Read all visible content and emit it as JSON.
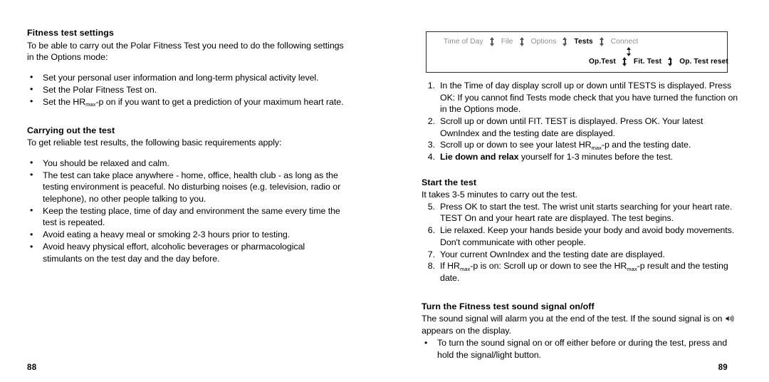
{
  "left_page": {
    "page_number": "88",
    "sections": [
      {
        "title": "Fitness test settings",
        "intro": "To be able to carry out the Polar Fitness Test you need to do the following settings in the Options mode:",
        "bullets": [
          {
            "pre": "Set your personal user information and long-term physical activity level.",
            "sub": "",
            "post": ""
          },
          {
            "pre": "Set the Polar Fitness Test on.",
            "sub": "",
            "post": ""
          },
          {
            "pre": "Set the HR",
            "sub": "max",
            "post": "-p on if you want to get a prediction of your maximum heart rate."
          }
        ]
      },
      {
        "title": "Carrying out the test",
        "intro": "To get reliable test results, the following basic requirements apply:",
        "bullets": [
          {
            "pre": "You should be relaxed and calm.",
            "sub": "",
            "post": ""
          },
          {
            "pre": "The test can take place anywhere - home, office, health club - as long as the testing environment is peaceful. No disturbing noises (e.g. television, radio or telephone), no other people talking to you.",
            "sub": "",
            "post": ""
          },
          {
            "pre": "Keep the testing place, time of day and environment the same every time the test is repeated.",
            "sub": "",
            "post": ""
          },
          {
            "pre": "Avoid eating a heavy meal or smoking 2-3 hours prior to testing.",
            "sub": "",
            "post": ""
          },
          {
            "pre": "Avoid heavy physical effort, alcoholic beverages or pharmacological stimulants on the test day and the day before.",
            "sub": "",
            "post": ""
          }
        ]
      }
    ]
  },
  "right_page": {
    "page_number": "89",
    "menu_diagram": {
      "top_row": [
        "Time of Day",
        "File",
        "Options",
        "Tests",
        "Connect"
      ],
      "top_row_active": "Tests",
      "bottom_row": [
        "Op.Test",
        "Fit. Test",
        "Op. Test reset"
      ],
      "separator_icon": "up-down-arrow-icon",
      "branch_icon": "up-down-arrow-icon"
    },
    "steps_group_1": [
      {
        "num": "1.",
        "pre": "In the Time of day display scroll up or down until TESTS is displayed. Press OK: If you cannot find Tests mode check that you have turned the function on in the Options mode.",
        "bold": "",
        "sub": "",
        "post": ""
      },
      {
        "num": "2.",
        "pre": "Scroll up or down until FIT. TEST is displayed. Press OK. Your latest OwnIndex and the testing date are displayed.",
        "bold": "",
        "sub": "",
        "post": ""
      },
      {
        "num": "3.",
        "pre": "Scroll up or down to see your latest HR",
        "bold": "",
        "sub": "max",
        "post": "-p and the testing date."
      },
      {
        "num": "4.",
        "pre": "",
        "bold": "Lie down and relax",
        "sub": "",
        "post": " yourself for 1-3 minutes before the test."
      }
    ],
    "start_section": {
      "title": "Start the test",
      "intro": "It takes 3-5 minutes to carry out the test.",
      "steps": [
        {
          "num": "5.",
          "pre": "Press OK to start the test. The wrist unit starts searching for your heart rate. TEST On and your heart rate are displayed. The test begins.",
          "sub": "",
          "mid": "",
          "post": ""
        },
        {
          "num": "6.",
          "pre": "Lie relaxed. Keep your hands beside your body and avoid body movements. Don't communicate with other people.",
          "sub": "",
          "mid": "",
          "post": ""
        },
        {
          "num": "7.",
          "pre": "Your current OwnIndex and the testing date are displayed.",
          "sub": "",
          "mid": "",
          "post": ""
        },
        {
          "num": "8.",
          "pre": "If HR",
          "sub": "max",
          "mid": "-p is on: Scroll up or down to see the HR",
          "sub2": "max",
          "post": "-p result and the testing date."
        }
      ]
    },
    "sound_section": {
      "title": "Turn the Fitness test sound signal on/off",
      "intro_part1": "The sound signal will alarm you at the end of the test. If the sound signal is on ",
      "icon_name": "sound-signal-icon",
      "intro_part2": " appears on the display.",
      "bullets": [
        "To turn the sound signal on or off either before or during the test, press and hold the signal/light button."
      ]
    }
  },
  "colors": {
    "text": "#000000",
    "muted": "#8d8d8d",
    "border": "#2b2b2b",
    "background": "#ffffff"
  }
}
